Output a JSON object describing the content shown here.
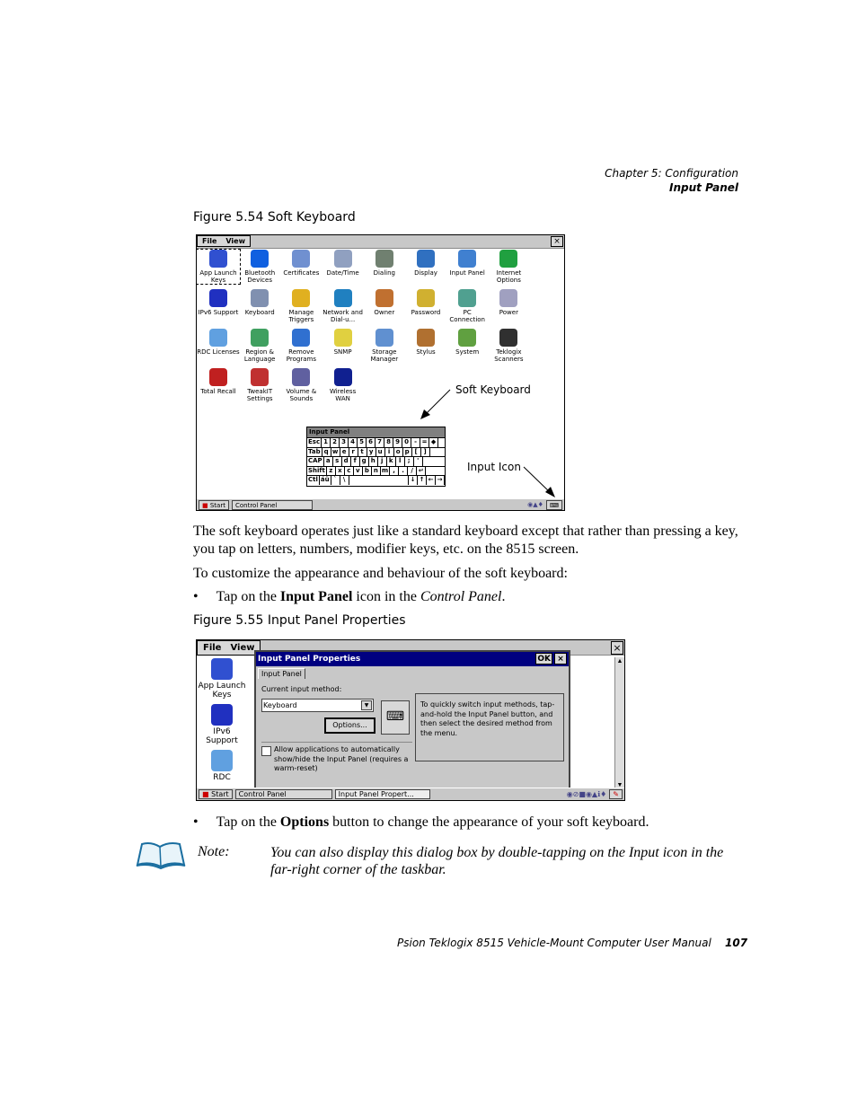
{
  "header": {
    "chapter": "Chapter  5:  Configuration",
    "section": "Input Panel"
  },
  "figure1": {
    "caption": "Figure 5.54 Soft Keyboard",
    "menu": [
      "File",
      "View"
    ],
    "close": "×",
    "items": [
      {
        "label": "App Launch Keys",
        "icon": "app-launch-keys-icon",
        "color": "#3050d0"
      },
      {
        "label": "Bluetooth Devices",
        "icon": "bluetooth-icon",
        "color": "#1060e0"
      },
      {
        "label": "Certificates",
        "icon": "certificates-icon",
        "color": "#7090d0"
      },
      {
        "label": "Date/Time",
        "icon": "date-time-icon",
        "color": "#90a0c0"
      },
      {
        "label": "Dialing",
        "icon": "dialing-icon",
        "color": "#708070"
      },
      {
        "label": "Display",
        "icon": "display-icon",
        "color": "#3070c0"
      },
      {
        "label": "Input Panel",
        "icon": "input-panel-icon",
        "color": "#4080d0"
      },
      {
        "label": "Internet Options",
        "icon": "internet-options-icon",
        "color": "#20a040"
      },
      {
        "label": "IPv6 Support",
        "icon": "ipv6-icon",
        "color": "#2030c0"
      },
      {
        "label": "Keyboard",
        "icon": "keyboard-icon",
        "color": "#8090b0"
      },
      {
        "label": "Manage Triggers",
        "icon": "manage-triggers-icon",
        "color": "#e0b020"
      },
      {
        "label": "Network and Dial-u...",
        "icon": "network-icon",
        "color": "#2080c0"
      },
      {
        "label": "Owner",
        "icon": "owner-icon",
        "color": "#c07030"
      },
      {
        "label": "Password",
        "icon": "password-icon",
        "color": "#d0b030"
      },
      {
        "label": "PC Connection",
        "icon": "pc-connection-icon",
        "color": "#50a090"
      },
      {
        "label": "Power",
        "icon": "power-icon",
        "color": "#a0a0c0"
      },
      {
        "label": "RDC Licenses",
        "icon": "rdc-licenses-icon",
        "color": "#60a0e0"
      },
      {
        "label": "Region & Language",
        "icon": "region-language-icon",
        "color": "#40a060"
      },
      {
        "label": "Remove Programs",
        "icon": "remove-programs-icon",
        "color": "#3070d0"
      },
      {
        "label": "SNMP",
        "icon": "snmp-icon",
        "color": "#e0d040"
      },
      {
        "label": "Storage Manager",
        "icon": "storage-manager-icon",
        "color": "#6090d0"
      },
      {
        "label": "Stylus",
        "icon": "stylus-icon",
        "color": "#b07030"
      },
      {
        "label": "System",
        "icon": "system-icon",
        "color": "#60a040"
      },
      {
        "label": "Teklogix Scanners",
        "icon": "barcode-icon",
        "color": "#303030"
      },
      {
        "label": "Total Recall",
        "icon": "total-recall-icon",
        "color": "#c02020"
      },
      {
        "label": "TweakIT Settings",
        "icon": "tweakit-icon",
        "color": "#c03030"
      },
      {
        "label": "Volume & Sounds",
        "icon": "volume-icon",
        "color": "#6060a0"
      },
      {
        "label": "Wireless WAN",
        "icon": "wireless-wan-icon",
        "color": "#102090"
      }
    ],
    "input_panel": {
      "title": "Input Panel",
      "rows": [
        [
          "Esc",
          "1",
          "2",
          "3",
          "4",
          "5",
          "6",
          "7",
          "8",
          "9",
          "0",
          "-",
          "=",
          "◆"
        ],
        [
          "Tab",
          "q",
          "w",
          "e",
          "r",
          "t",
          "y",
          "u",
          "i",
          "o",
          "p",
          "[",
          "]"
        ],
        [
          "CAP",
          "a",
          "s",
          "d",
          "f",
          "g",
          "h",
          "j",
          "k",
          "l",
          ";",
          "'"
        ],
        [
          "Shift",
          "z",
          "x",
          "c",
          "v",
          "b",
          "n",
          "m",
          ",",
          ".",
          "/",
          "↵"
        ],
        [
          "Ctl",
          "áü",
          "`",
          "\\",
          " ",
          "↓",
          "↑",
          "←",
          "→"
        ]
      ]
    },
    "callout_soft_keyboard": "Soft Keyboard",
    "callout_input_icon": "Input Icon",
    "taskbar": {
      "start": "Start",
      "task": "Control Panel"
    }
  },
  "para1": "The soft keyboard operates just like a standard keyboard except that rather than pressing a key, you tap on letters, numbers, modifier keys, etc. on the 8515 screen.",
  "para2": "To customize the appearance and behaviour of the soft keyboard:",
  "bullet1": {
    "pre": "Tap on the ",
    "bold": "Input Panel",
    "mid": " icon in the ",
    "ital": "Control Panel",
    "post": "."
  },
  "figure2": {
    "caption": "Figure 5.55 Input Panel Properties",
    "menu": [
      "File",
      "View"
    ],
    "dialog": {
      "title": "Input Panel Properties",
      "ok": "OK",
      "close": "×",
      "tab": "Input Panel",
      "method_label": "Current input method:",
      "method_value": "Keyboard",
      "options": "Options...",
      "checkbox": "Allow applications to automatically show/hide the Input Panel (requires a warm-reset)",
      "checked": false,
      "hint": "To quickly switch input methods, tap-and-hold the Input Panel button, and then select the desired method from the menu."
    },
    "bg_items": [
      {
        "label": "App Launch Keys",
        "color": "#3050d0"
      },
      {
        "label": "IPv6 Support",
        "color": "#2030c0"
      },
      {
        "label": "RDC",
        "color": "#60a0e0"
      }
    ],
    "taskbar": {
      "start": "Start",
      "task1": "Control Panel",
      "task2": "Input Panel Propert..."
    }
  },
  "bullet2": {
    "pre": "Tap on the ",
    "bold": "Options",
    "post": " button to change the appearance of your soft keyboard."
  },
  "note": {
    "label": "Note:",
    "text": "You can also display this dialog box by double-tapping on the Input icon in the far-right corner of the taskbar."
  },
  "footer": {
    "title": "Psion Teklogix 8515 Vehicle-Mount Computer User Manual",
    "page": "107"
  }
}
